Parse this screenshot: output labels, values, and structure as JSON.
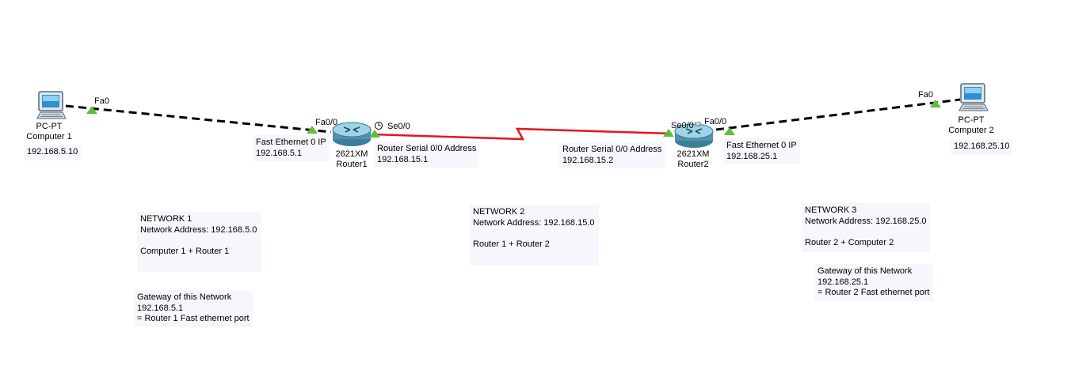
{
  "devices": {
    "computer1": {
      "model": "PC-PT",
      "name": "Computer 1",
      "ip": "192.168.5.10",
      "port": "Fa0"
    },
    "router1": {
      "model": "2621XM",
      "name": "Router1",
      "fa_port": "Fa0/0",
      "se_port": "Se0/0"
    },
    "router2": {
      "model": "2621XM",
      "name": "Router2",
      "fa_port": "Fa0/0",
      "se_port": "Se0/0"
    },
    "computer2": {
      "model": "PC-PT",
      "name": "Computer 2",
      "ip": "192.168.25.10",
      "port": "Fa0"
    }
  },
  "interface_notes": {
    "r1_fa": {
      "line1": "Fast Ethernet 0 IP",
      "line2": "192.168.5.1"
    },
    "r1_se": {
      "line1": "Router Serial 0/0 Address",
      "line2": "192.168.15.1"
    },
    "r2_se": {
      "line1": "Router Serial 0/0 Address",
      "line2": "192.168.15.2"
    },
    "r2_fa": {
      "line1": "Fast Ethernet 0 IP",
      "line2": "192.168.25.1"
    }
  },
  "network_notes": {
    "net1": {
      "line1": "NETWORK 1",
      "line2": "Network Address: 192.168.5.0",
      "line3": "",
      "line4": "Computer 1 + Router 1"
    },
    "net2": {
      "line1": "NETWORK 2",
      "line2": "Network Address: 192.168.15.0",
      "line3": "",
      "line4": "Router 1 + Router 2"
    },
    "net3": {
      "line1": "NETWORK 3",
      "line2": "Network Address: 192.168.25.0",
      "line3": "",
      "line4": "Router 2 + Computer 2"
    }
  },
  "gateway_notes": {
    "gw1": {
      "line1": "Gateway of this Network",
      "line2": "192.168.5.1",
      "line3": "= Router 1 Fast ethernet port"
    },
    "gw3": {
      "line1": "Gateway of this Network",
      "line2": "192.168.25.1",
      "line3": "= Router 2 Fast ethernet port"
    }
  },
  "colors": {
    "ethernet_link": "#000000",
    "serial_link": "#e8151b",
    "link_up_indicator": "#5cbf3a",
    "note_background": "#f6f7fc"
  },
  "icons": {
    "computer": "pc-icon",
    "router": "router-icon",
    "clock": "clock-icon"
  }
}
